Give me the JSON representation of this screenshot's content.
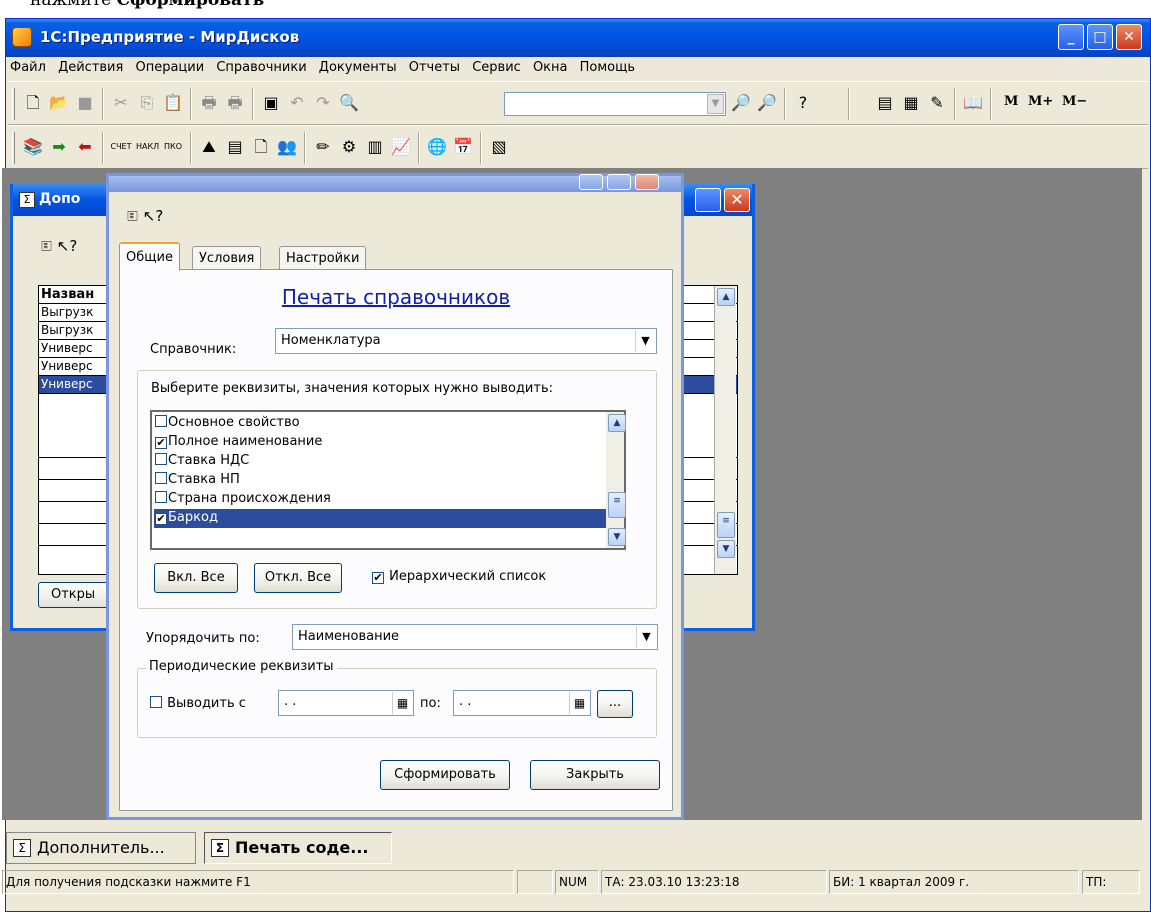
{
  "caption": {
    "prefix": "нажмите ",
    "bold": "Сформировать"
  },
  "app": {
    "title": "1С:Предприятие - МирДисков"
  },
  "menu": [
    "Файл",
    "Действия",
    "Операции",
    "Справочники",
    "Документы",
    "Отчеты",
    "Сервис",
    "Окна",
    "Помощь"
  ],
  "toolbar": {
    "mem_buttons": [
      "M",
      "M+",
      "M−"
    ],
    "search_value": ""
  },
  "bg_window": {
    "title": "Допо",
    "header": "Назван",
    "rows": [
      "Выгрузк",
      "Выгрузк",
      "Универс",
      "Универс",
      "Универс"
    ],
    "open_button": "Откры"
  },
  "dialog": {
    "tabs": [
      "Общие",
      "Условия",
      "Настройки"
    ],
    "heading": "Печать справочников",
    "catalog_label": "Справочник:",
    "catalog_value": "Номенклатура",
    "attrs_group_label": "Выберите реквизиты, значения которых нужно выводить:",
    "attrs": [
      {
        "label": "Основное свойство",
        "checked": false
      },
      {
        "label": "Полное наименование",
        "checked": true
      },
      {
        "label": "Ставка НДС",
        "checked": false
      },
      {
        "label": "Ставка НП",
        "checked": false
      },
      {
        "label": "Страна происхождения",
        "checked": false
      },
      {
        "label": "Баркод",
        "checked": true
      }
    ],
    "select_all": "Вкл. Все",
    "deselect_all": "Откл. Все",
    "hierarchical_label": "Иерархический список",
    "order_label": "Упорядочить по:",
    "order_value": "Наименование",
    "periodic_group_label": "Периодические реквизиты",
    "output_from_label": "Выводить с",
    "date_from": " .  .",
    "to_label": "по:",
    "date_to": " .  .",
    "ellipsis": "...",
    "generate_button": "Сформировать",
    "close_button": "Закрыть"
  },
  "taskbar": {
    "items": [
      "Дополнитель...",
      "Печать соде..."
    ]
  },
  "statusbar": {
    "hint": "Для получения подсказки нажмите F1",
    "num": "NUM",
    "ta": "ТА: 23.03.10  13:23:18",
    "bi": "БИ: 1 квартал 2009 г.",
    "tp": "ТП:"
  },
  "colors": {
    "titlebar": "#0054e3",
    "selection": "#2c4c9e",
    "heading": "#1122a8",
    "mdi": "#808080"
  }
}
